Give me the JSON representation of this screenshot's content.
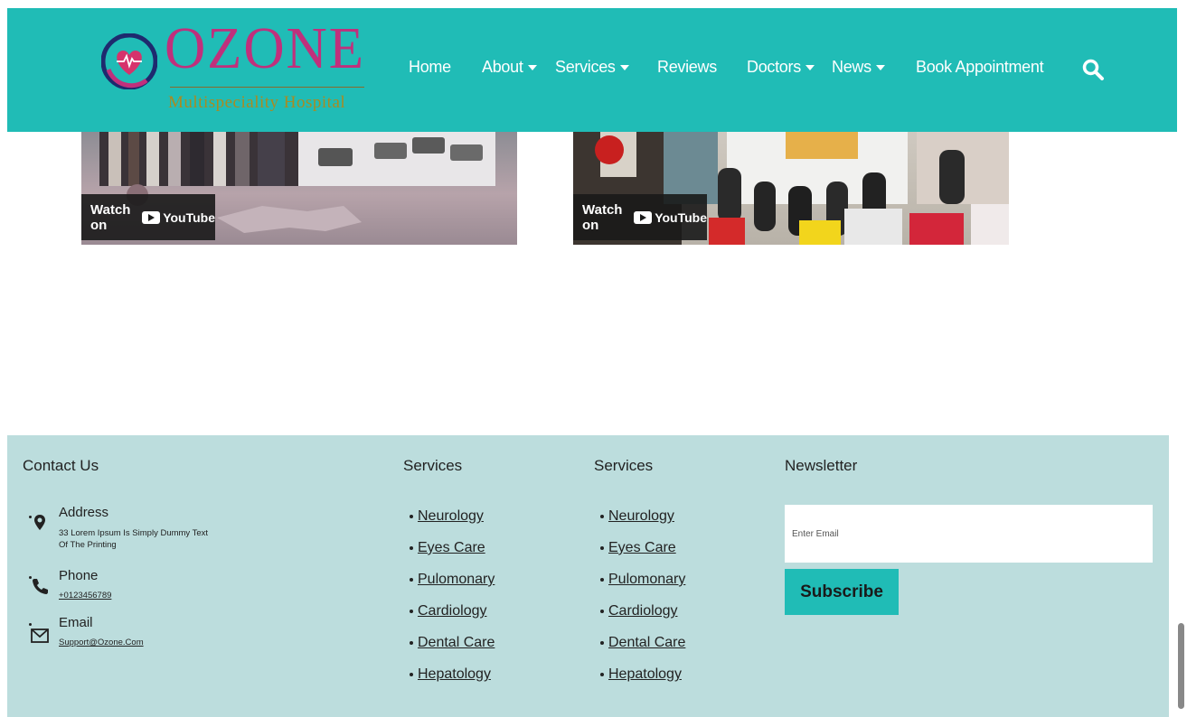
{
  "brand": {
    "name": "OZONE",
    "tagline": "Multispeciality Hospital",
    "colors": {
      "primary": "#20bcb6",
      "accent": "#c0307c",
      "gold": "#a98b22",
      "footer_bg": "#bcdddd"
    }
  },
  "nav": {
    "items": [
      {
        "label": "Home",
        "dropdown": false
      },
      {
        "label": "About",
        "dropdown": true
      },
      {
        "label": "Services",
        "dropdown": true
      },
      {
        "label": "Reviews",
        "dropdown": false
      },
      {
        "label": "Doctors",
        "dropdown": true
      },
      {
        "label": "News",
        "dropdown": true
      },
      {
        "label": "Book Appointment",
        "dropdown": false
      }
    ],
    "search_icon": "search-icon"
  },
  "videos": [
    {
      "watch_label": "Watch on",
      "platform": "YouTube"
    },
    {
      "watch_label": "Watch on",
      "platform": "YouTube"
    }
  ],
  "footer": {
    "contact": {
      "title": "Contact Us",
      "address": {
        "icon": "map-pin-icon",
        "label": "Address",
        "value": "33 Lorem Ipsum Is Simply Dummy Text Of The Printing"
      },
      "phone": {
        "icon": "phone-icon",
        "label": "Phone",
        "value": "+0123456789"
      },
      "email": {
        "icon": "mail-icon",
        "label": "Email",
        "value": "Support@Ozone.Com"
      }
    },
    "services_1": {
      "title": "Services",
      "items": [
        "Neurology",
        "Eyes Care",
        "Pulomonary",
        "Cardiology",
        "Dental Care",
        "Hepatology"
      ]
    },
    "services_2": {
      "title": "Services",
      "items": [
        "Neurology",
        "Eyes Care",
        "Pulomonary",
        "Cardiology",
        "Dental Care",
        "Hepatology"
      ]
    },
    "newsletter": {
      "title": "Newsletter",
      "placeholder": "Enter Email",
      "button": "Subscribe"
    }
  }
}
